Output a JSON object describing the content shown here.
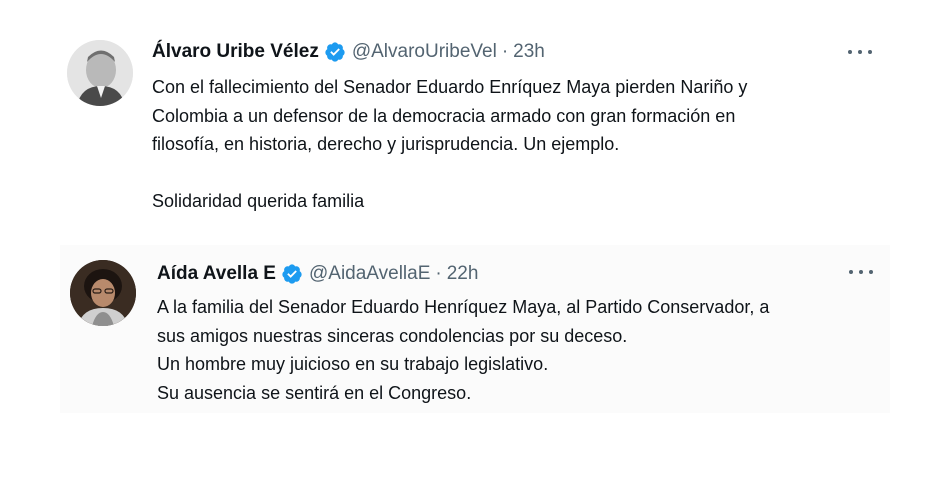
{
  "tweets": [
    {
      "display_name": "Álvaro Uribe Vélez",
      "verified_icon": "verified-badge-icon",
      "handle": "@AlvaroUribeVel",
      "separator": "·",
      "time": "23h",
      "more_icon": "more-options-icon",
      "lines": [
        "Con el fallecimiento del Senador Eduardo Enríquez Maya pierden Nariño y",
        "Colombia a un defensor de la democracia armado con gran formación en",
        "filosofía, en historia, derecho y jurisprudencia.  Un ejemplo.",
        "",
        "Solidaridad querida familia"
      ]
    },
    {
      "display_name": "Aída Avella E",
      "verified_icon": "verified-badge-icon",
      "handle": "@AidaAvellaE",
      "separator": "·",
      "time": "22h",
      "more_icon": "more-options-icon",
      "lines": [
        "A la familia del Senador Eduardo Henríquez Maya, al Partido Conservador, a",
        "sus amigos nuestras sinceras condolencias por su deceso.",
        "Un hombre muy juicioso en su trabajo legislativo.",
        "Su ausencia se sentirá  en el Congreso."
      ]
    }
  ],
  "colors": {
    "text_primary": "#0f1419",
    "text_secondary": "#536471",
    "verified_blue": "#1d9bf0"
  }
}
